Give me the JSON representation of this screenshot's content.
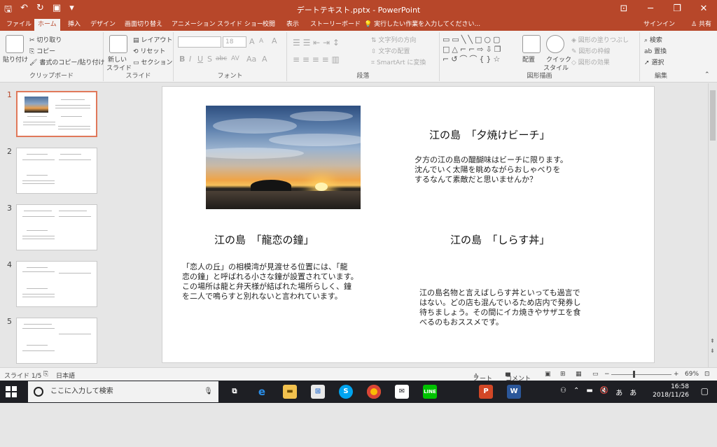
{
  "window": {
    "title": "デートテキスト.pptx - PowerPoint",
    "qat": [
      "save-icon",
      "undo-icon",
      "redo-icon",
      "present-icon",
      "customize-icon"
    ]
  },
  "tabs": {
    "items": [
      "ファイル",
      "ホーム",
      "挿入",
      "デザイン",
      "画面切り替え",
      "アニメーション",
      "スライド ショー",
      "校閲",
      "表示",
      "ストーリーボード"
    ],
    "active": "ホーム",
    "tellme": "実行したい作業を入力してください...",
    "signin": "サインイン",
    "share": "共有"
  },
  "ribbon": {
    "clipboard": {
      "label": "クリップボード",
      "paste": "貼り付け",
      "cut": "切り取り",
      "copy": "コピー",
      "format_painter": "書式のコピー/貼り付け"
    },
    "slides": {
      "label": "スライド",
      "new_slide": "新しい",
      "new_slide2": "スライド",
      "layout": "レイアウト",
      "reset": "リセット",
      "section": "セクション"
    },
    "font": {
      "label": "フォント",
      "size": "18",
      "bold": "B",
      "italic": "I",
      "underline": "U",
      "strike": "S",
      "shadow": "abc",
      "spacing": "AV",
      "case": "Aa",
      "color": "A",
      "grow": "A",
      "shrink": "A"
    },
    "paragraph": {
      "label": "段落",
      "text_direction": "文字列の方向",
      "align_text": "文字の配置",
      "smartart": "SmartArt に変換"
    },
    "drawing": {
      "label": "図形描画",
      "arrange": "配置",
      "quick_styles": "クイック",
      "quick_styles2": "スタイル",
      "shape_fill": "図形の塗りつぶし",
      "shape_outline": "図形の枠線",
      "shape_effects": "図形の効果"
    },
    "editing": {
      "label": "編集",
      "find": "検索",
      "replace": "置換",
      "select": "選択"
    }
  },
  "thumbnails": [
    {
      "num": "1",
      "active": true
    },
    {
      "num": "2",
      "active": false
    },
    {
      "num": "3",
      "active": false
    },
    {
      "num": "4",
      "active": false
    },
    {
      "num": "5",
      "active": false
    }
  ],
  "slide": {
    "t1": "江の島　「夕焼けビーチ」",
    "b1": [
      "夕方の江の島の醍醐味はビーチに限ります。",
      "沈んでいく太陽を眺めながらおしゃべりを",
      "するなんて素敵だと思いませんか？"
    ],
    "t2": "江の島　「龍恋の鐘」",
    "b2": [
      "「恋人の丘」の相模湾が見渡せる位置には、「龍",
      "恋の鐘」と呼ばれる小さな鐘が設置されています。",
      "この場所は龍と弁天様が結ばれた場所らしく、鐘",
      "を二人で鳴らすと別れないと言われています。"
    ],
    "t3": "江の島　「しらす丼」",
    "b3": [
      "江の島名物と言えばしらす丼といっても過言で",
      "はない。どの店も混んでいるため店内で発券し",
      "待ちましょう。その間にイカ焼きやサザエを食",
      "べるのもおススメです。"
    ]
  },
  "status": {
    "slide_count": "スライド 1/5",
    "language": "日本語",
    "notes": "ノート",
    "comments": "コメント",
    "zoom": "69%"
  },
  "taskbar": {
    "search_placeholder": "ここに入力して検索",
    "time": "16:58",
    "date": "2018/11/26",
    "ime": "あ",
    "apps": [
      "edge-icon",
      "explorer-icon",
      "store-icon",
      "skype-icon",
      "chrome-icon",
      "mail-icon",
      "line-icon",
      "powerpoint-icon",
      "word-icon"
    ]
  },
  "colors": {
    "accent": "#b7472a",
    "ribbon": "#f3f3f3",
    "taskbar": "#1e1f24"
  }
}
